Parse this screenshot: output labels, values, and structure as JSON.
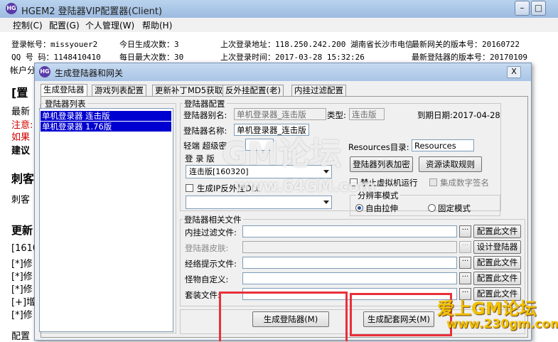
{
  "main_window": {
    "title": "HGEM2 登陆器VIP配置器(Client)",
    "menu": [
      "控制(C)",
      "配置(G)",
      "个人管理(W)",
      "帮助(H)"
    ]
  },
  "info": {
    "login_account": "登录帐号：missyouer2",
    "qq": "QQ 号 码：1148410410",
    "today_gen": "今日生成次数：3",
    "daily_max": "每日最大次数：30",
    "last_addr": "上次登录地址：118.250.242.200 湖南省长沙市电信",
    "last_time": "上次登录时间：2017-03-28 15:32:26",
    "gateway_version": "最新网关的版本号：20160722",
    "launcher_version": "最新登陆器的版本号：20170109"
  },
  "background_text": {
    "account_partial": "帐户分",
    "section1": "[置",
    "newest": "最新",
    "note": "注意:",
    "ifx": "如果",
    "advice": "建议",
    "cike": "刺客",
    "cike2": "刺客",
    "update": "更新",
    "log": [
      "[1610",
      "[*]修",
      "[*]修",
      "[*]修",
      "[+]增",
      "[*]修"
    ],
    "config": "配置"
  },
  "dialog": {
    "title": "生成登陆器和网关",
    "close": "X",
    "tabs": [
      "生成登陆器",
      "游戏列表配置",
      "更新补丁MD5获取",
      "反外挂配置(老)",
      "内挂过滤配置"
    ],
    "list_group": "登陆器列表",
    "list_items": [
      "单机登录器 连击版",
      "单机登录器 1.76版"
    ],
    "config_group": "登陆器配置",
    "alias_label": "登陆器别名:",
    "alias_value": "单机登录器_连击版",
    "type_label": "类型:",
    "type_value": "连击版",
    "expire": "到期日期:2017-04-28",
    "name_label": "登陆器名称:",
    "name_value": "单机登录器_连击版",
    "light_label": "轻端 超级密",
    "resources_label": "Resources目录:",
    "resources_value": "Resources",
    "client_label": "登   录 版",
    "client_combo": "连击版[160320]",
    "list_encrypt_btn": "登陆器列表加密",
    "resource_rule_btn": "资源读取规则",
    "disable_vm": "禁止虚拟机运行",
    "digital_sign": "集成数字签名",
    "gen_anti_cheat": "生成IP反外挂DLL",
    "resolution_group": "分辨率模式",
    "free_stretch": "自由拉伸",
    "fixed_mode": "固定模式",
    "files_group": "登陆器相关文件",
    "file_rows": [
      {
        "label": "内挂过滤文件:",
        "button": "配置此文件",
        "disabled": false
      },
      {
        "label": "登陆器皮肤:",
        "button": "设计登陆器",
        "disabled": true
      },
      {
        "label": "经络提示文件:",
        "button": "配置此文件",
        "disabled": false
      },
      {
        "label": "怪物自定义:",
        "button": "配置此文件",
        "disabled": false
      },
      {
        "label": "套装文件:",
        "button": "配置此文件",
        "disabled": false
      }
    ],
    "dots": "···",
    "gen_launcher_btn": "生成登陆器(M)",
    "gen_gateway_btn": "生成配套网关(M)"
  },
  "watermarks": {
    "center_big": "GM论坛",
    "center_url": "www.64GM.com",
    "corner_title": "爱上GM论坛",
    "corner_url": "www.230gm.com"
  },
  "colors": {
    "highlight_red": "#e8303a",
    "list_selection": "#0000d0",
    "note_red": "#d00000"
  }
}
